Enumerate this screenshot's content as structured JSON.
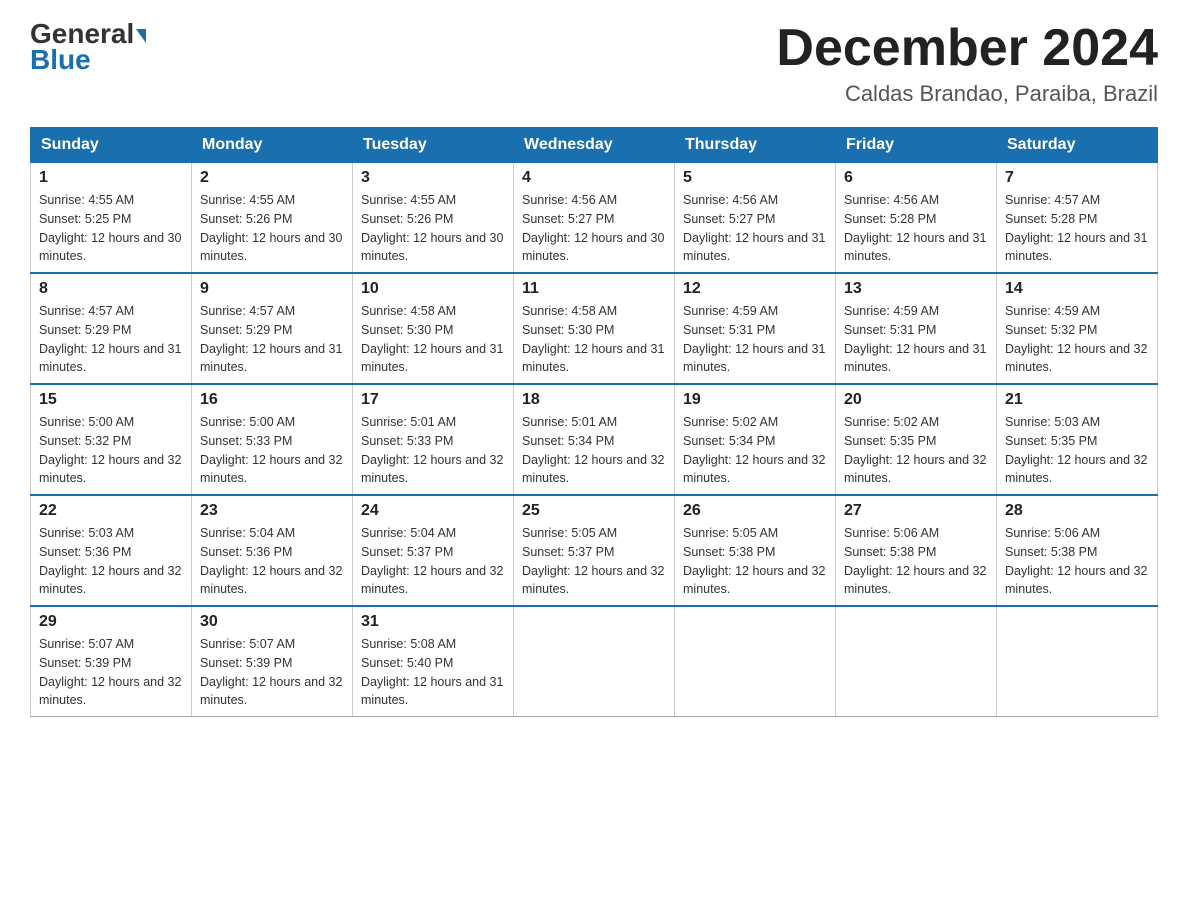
{
  "header": {
    "logo_general": "General",
    "logo_blue": "Blue",
    "month_title": "December 2024",
    "location": "Caldas Brandao, Paraiba, Brazil"
  },
  "days_of_week": [
    "Sunday",
    "Monday",
    "Tuesday",
    "Wednesday",
    "Thursday",
    "Friday",
    "Saturday"
  ],
  "weeks": [
    [
      {
        "day": "1",
        "sunrise": "4:55 AM",
        "sunset": "5:25 PM",
        "daylight": "12 hours and 30 minutes."
      },
      {
        "day": "2",
        "sunrise": "4:55 AM",
        "sunset": "5:26 PM",
        "daylight": "12 hours and 30 minutes."
      },
      {
        "day": "3",
        "sunrise": "4:55 AM",
        "sunset": "5:26 PM",
        "daylight": "12 hours and 30 minutes."
      },
      {
        "day": "4",
        "sunrise": "4:56 AM",
        "sunset": "5:27 PM",
        "daylight": "12 hours and 30 minutes."
      },
      {
        "day": "5",
        "sunrise": "4:56 AM",
        "sunset": "5:27 PM",
        "daylight": "12 hours and 31 minutes."
      },
      {
        "day": "6",
        "sunrise": "4:56 AM",
        "sunset": "5:28 PM",
        "daylight": "12 hours and 31 minutes."
      },
      {
        "day": "7",
        "sunrise": "4:57 AM",
        "sunset": "5:28 PM",
        "daylight": "12 hours and 31 minutes."
      }
    ],
    [
      {
        "day": "8",
        "sunrise": "4:57 AM",
        "sunset": "5:29 PM",
        "daylight": "12 hours and 31 minutes."
      },
      {
        "day": "9",
        "sunrise": "4:57 AM",
        "sunset": "5:29 PM",
        "daylight": "12 hours and 31 minutes."
      },
      {
        "day": "10",
        "sunrise": "4:58 AM",
        "sunset": "5:30 PM",
        "daylight": "12 hours and 31 minutes."
      },
      {
        "day": "11",
        "sunrise": "4:58 AM",
        "sunset": "5:30 PM",
        "daylight": "12 hours and 31 minutes."
      },
      {
        "day": "12",
        "sunrise": "4:59 AM",
        "sunset": "5:31 PM",
        "daylight": "12 hours and 31 minutes."
      },
      {
        "day": "13",
        "sunrise": "4:59 AM",
        "sunset": "5:31 PM",
        "daylight": "12 hours and 31 minutes."
      },
      {
        "day": "14",
        "sunrise": "4:59 AM",
        "sunset": "5:32 PM",
        "daylight": "12 hours and 32 minutes."
      }
    ],
    [
      {
        "day": "15",
        "sunrise": "5:00 AM",
        "sunset": "5:32 PM",
        "daylight": "12 hours and 32 minutes."
      },
      {
        "day": "16",
        "sunrise": "5:00 AM",
        "sunset": "5:33 PM",
        "daylight": "12 hours and 32 minutes."
      },
      {
        "day": "17",
        "sunrise": "5:01 AM",
        "sunset": "5:33 PM",
        "daylight": "12 hours and 32 minutes."
      },
      {
        "day": "18",
        "sunrise": "5:01 AM",
        "sunset": "5:34 PM",
        "daylight": "12 hours and 32 minutes."
      },
      {
        "day": "19",
        "sunrise": "5:02 AM",
        "sunset": "5:34 PM",
        "daylight": "12 hours and 32 minutes."
      },
      {
        "day": "20",
        "sunrise": "5:02 AM",
        "sunset": "5:35 PM",
        "daylight": "12 hours and 32 minutes."
      },
      {
        "day": "21",
        "sunrise": "5:03 AM",
        "sunset": "5:35 PM",
        "daylight": "12 hours and 32 minutes."
      }
    ],
    [
      {
        "day": "22",
        "sunrise": "5:03 AM",
        "sunset": "5:36 PM",
        "daylight": "12 hours and 32 minutes."
      },
      {
        "day": "23",
        "sunrise": "5:04 AM",
        "sunset": "5:36 PM",
        "daylight": "12 hours and 32 minutes."
      },
      {
        "day": "24",
        "sunrise": "5:04 AM",
        "sunset": "5:37 PM",
        "daylight": "12 hours and 32 minutes."
      },
      {
        "day": "25",
        "sunrise": "5:05 AM",
        "sunset": "5:37 PM",
        "daylight": "12 hours and 32 minutes."
      },
      {
        "day": "26",
        "sunrise": "5:05 AM",
        "sunset": "5:38 PM",
        "daylight": "12 hours and 32 minutes."
      },
      {
        "day": "27",
        "sunrise": "5:06 AM",
        "sunset": "5:38 PM",
        "daylight": "12 hours and 32 minutes."
      },
      {
        "day": "28",
        "sunrise": "5:06 AM",
        "sunset": "5:38 PM",
        "daylight": "12 hours and 32 minutes."
      }
    ],
    [
      {
        "day": "29",
        "sunrise": "5:07 AM",
        "sunset": "5:39 PM",
        "daylight": "12 hours and 32 minutes."
      },
      {
        "day": "30",
        "sunrise": "5:07 AM",
        "sunset": "5:39 PM",
        "daylight": "12 hours and 32 minutes."
      },
      {
        "day": "31",
        "sunrise": "5:08 AM",
        "sunset": "5:40 PM",
        "daylight": "12 hours and 31 minutes."
      },
      null,
      null,
      null,
      null
    ]
  ]
}
